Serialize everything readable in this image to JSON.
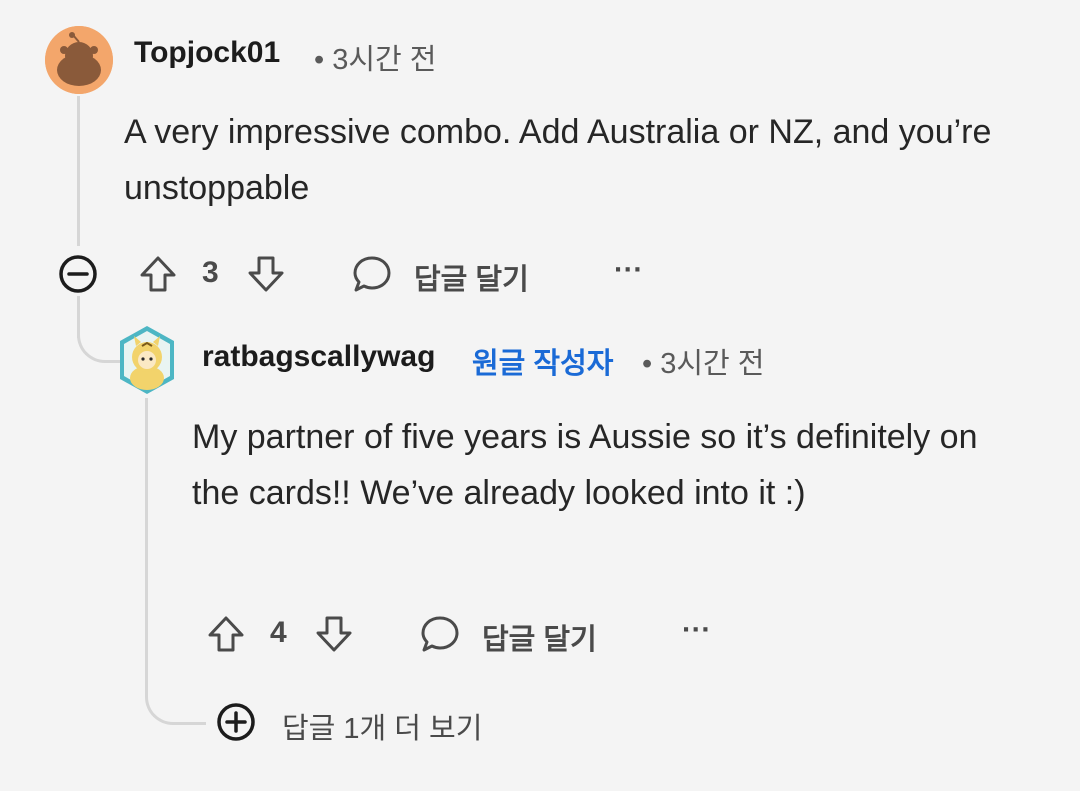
{
  "comment1": {
    "author": "Topjock01",
    "time": "• 3시간 전",
    "body": "A very impressive combo. Add Australia or NZ, and you’re unstoppable",
    "votes": "3",
    "reply_label": "답글 달기",
    "more": "···"
  },
  "comment2": {
    "author": "ratbagscallywag",
    "op_badge": "원글 작성자",
    "time": "• 3시간 전",
    "body": "My partner of five years is Aussie so it’s definitely on the cards!! We’ve already looked into it :)",
    "votes": "4",
    "reply_label": "답글 달기",
    "more": "···"
  },
  "more_replies": {
    "label": "답글 1개 더 보기"
  },
  "colors": {
    "background": "#f4f4f4",
    "op_badge": "#1a6ad6",
    "avatar1": "#f3a66b",
    "avatar2": "#4db6c4"
  }
}
